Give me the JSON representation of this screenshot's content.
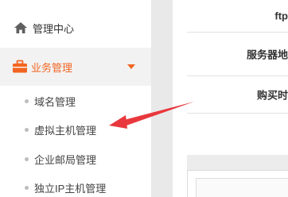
{
  "sidebar": {
    "top_item": {
      "label": "管理中心",
      "icon": "home-icon"
    },
    "section": {
      "label": "业务管理",
      "icon": "briefcase-icon",
      "accent": "#f26522"
    },
    "sub_items": [
      {
        "label": "域名管理"
      },
      {
        "label": "虚拟主机管理"
      },
      {
        "label": "企业邮局管理"
      },
      {
        "label": "独立IP主机管理"
      }
    ]
  },
  "table": {
    "rows": [
      {
        "label": "ftp"
      },
      {
        "label": "服务器地"
      },
      {
        "label": "购买时"
      }
    ]
  },
  "annotation": {
    "color": "#e8383d"
  }
}
